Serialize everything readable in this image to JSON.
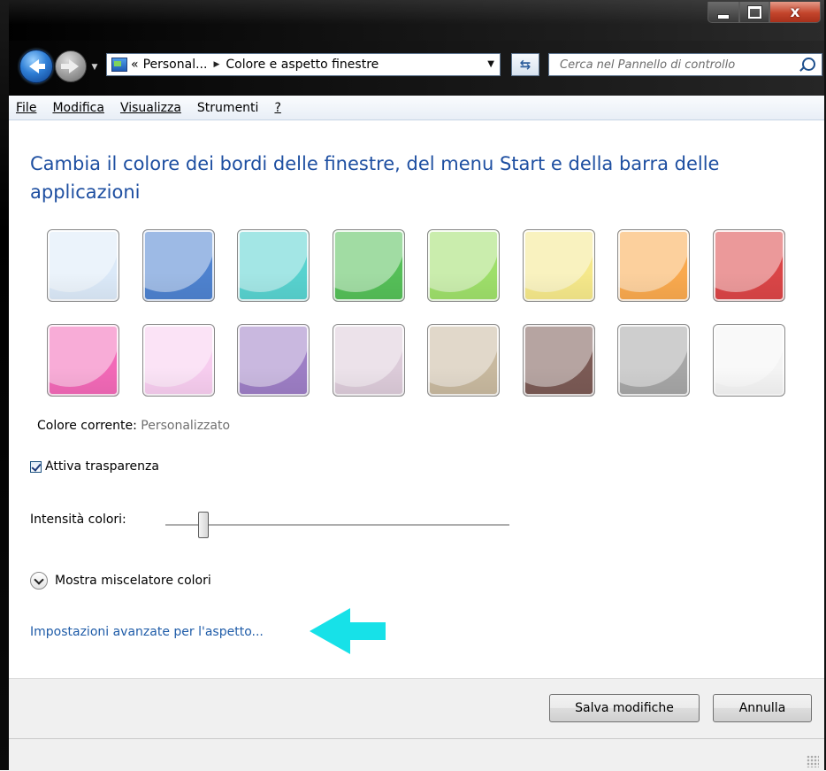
{
  "window": {
    "minimize_label": "minimize",
    "maximize_label": "maximize",
    "close_glyph": "x"
  },
  "nav": {
    "back_icon": "back-arrow-icon",
    "forward_icon": "forward-arrow-icon",
    "breadcrumb_prefix": "«",
    "breadcrumb": [
      "Personal...",
      "Colore e aspetto finestre"
    ],
    "search_placeholder": "Cerca nel Pannello di controllo"
  },
  "menu": [
    {
      "label": "File"
    },
    {
      "label": "Modifica"
    },
    {
      "label": "Visualizza"
    },
    {
      "label": "Strumenti"
    },
    {
      "label": "?"
    }
  ],
  "content": {
    "heading": "Cambia il colore dei bordi delle finestre, del menu Start e della barra delle applicazioni",
    "swatch_colors": [
      "#dbe9f8",
      "#4e82cf",
      "#58d2cf",
      "#55bf58",
      "#9edf6a",
      "#f5e88a",
      "#f9a94e",
      "#da4547",
      "#f269b7",
      "#f7cdef",
      "#9d7ec5",
      "#dccbd9",
      "#c8b99f",
      "#7b5a55",
      "#a6a6a6",
      "#f4f4f4"
    ],
    "current_color_label": "Colore corrente:",
    "current_color_value": "Personalizzato",
    "transparency_label": "Attiva trasparenza",
    "transparency_checked": true,
    "intensity_label": "Intensità colori:",
    "intensity_value": 0.11,
    "mixer_label": "Mostra miscelatore colori",
    "advanced_link": "Impostazioni avanzate per l'aspetto...",
    "annotation_arrow_color": "#17e1e8"
  },
  "buttons": {
    "save": "Salva modifiche",
    "cancel": "Annulla"
  }
}
